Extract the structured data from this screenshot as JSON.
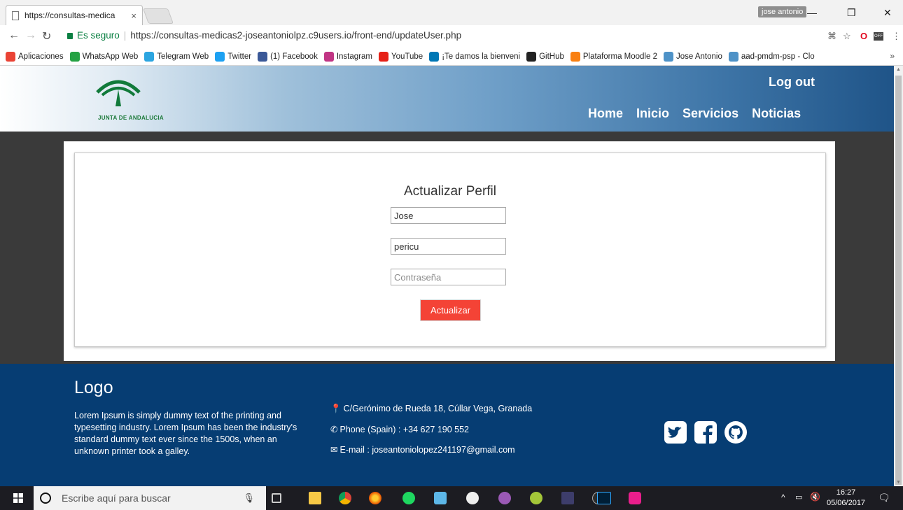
{
  "browser": {
    "tab_title": "https://consultas-medica",
    "tab_close": "×",
    "profile_name": "jose antonio",
    "secure_label": "Es seguro",
    "url": "https://consultas-medicas2-joseantoniolpz.c9users.io/front-end/updateUser.php",
    "bookmarks": [
      {
        "label": "Aplicaciones",
        "icon": "apps-grid-icon",
        "color": "#ea4335"
      },
      {
        "label": "WhatsApp Web",
        "icon": "whatsapp-icon",
        "color": "#25a244"
      },
      {
        "label": "Telegram Web",
        "icon": "telegram-icon",
        "color": "#2ca5e0"
      },
      {
        "label": "Twitter",
        "icon": "twitter-icon",
        "color": "#1da1f2"
      },
      {
        "label": "(1) Facebook",
        "icon": "facebook-icon",
        "color": "#3b5998"
      },
      {
        "label": "Instagram",
        "icon": "instagram-icon",
        "color": "#c13584"
      },
      {
        "label": "YouTube",
        "icon": "youtube-icon",
        "color": "#e62117"
      },
      {
        "label": "¡Te damos la bienveni",
        "icon": "linkedin-icon",
        "color": "#0077b5"
      },
      {
        "label": "GitHub",
        "icon": "github-icon",
        "color": "#222222"
      },
      {
        "label": "Plataforma Moodle 2",
        "icon": "moodle-icon",
        "color": "#f98012"
      },
      {
        "label": "Jose Antonio",
        "icon": "cloud9-icon",
        "color": "#4e92c7"
      },
      {
        "label": "aad-pmdm-psp - Clo",
        "icon": "cloud9-icon",
        "color": "#4e92c7"
      }
    ],
    "bookmarks_more": "»"
  },
  "header": {
    "logo_text": "JUNTA DE ANDALUCIA",
    "logout_label": "Log out",
    "nav": [
      {
        "label": "Home"
      },
      {
        "label": "Inicio"
      },
      {
        "label": "Servicios"
      },
      {
        "label": "Noticias"
      }
    ]
  },
  "form": {
    "title": "Actualizar Perfil",
    "name_value": "Jose",
    "user_value": "pericu",
    "password_value": "",
    "password_placeholder": "Contraseña",
    "submit_label": "Actualizar"
  },
  "footer": {
    "logo": "Logo",
    "text": "Lorem Ipsum is simply dummy text of the printing and typesetting industry. Lorem Ipsum has been the industry's standard dummy text ever since the 1500s, when an unknown printer took a galley.",
    "address": "C/Gerónimo de Rueda 18, Cúllar Vega, Granada",
    "phone": "Phone (Spain) : +34 627 190 552",
    "email": "E-mail : joseantoniolopez241197@gmail.com",
    "social": [
      "twitter-icon",
      "facebook-icon",
      "github-icon"
    ]
  },
  "taskbar": {
    "search_placeholder": "Escribe aquí para buscar",
    "time": "16:27",
    "date": "05/06/2017"
  },
  "colors": {
    "accent_red": "#f44336",
    "footer_blue": "#063d73",
    "page_dark": "#3a3a3a",
    "secure_green": "#0b8043"
  }
}
